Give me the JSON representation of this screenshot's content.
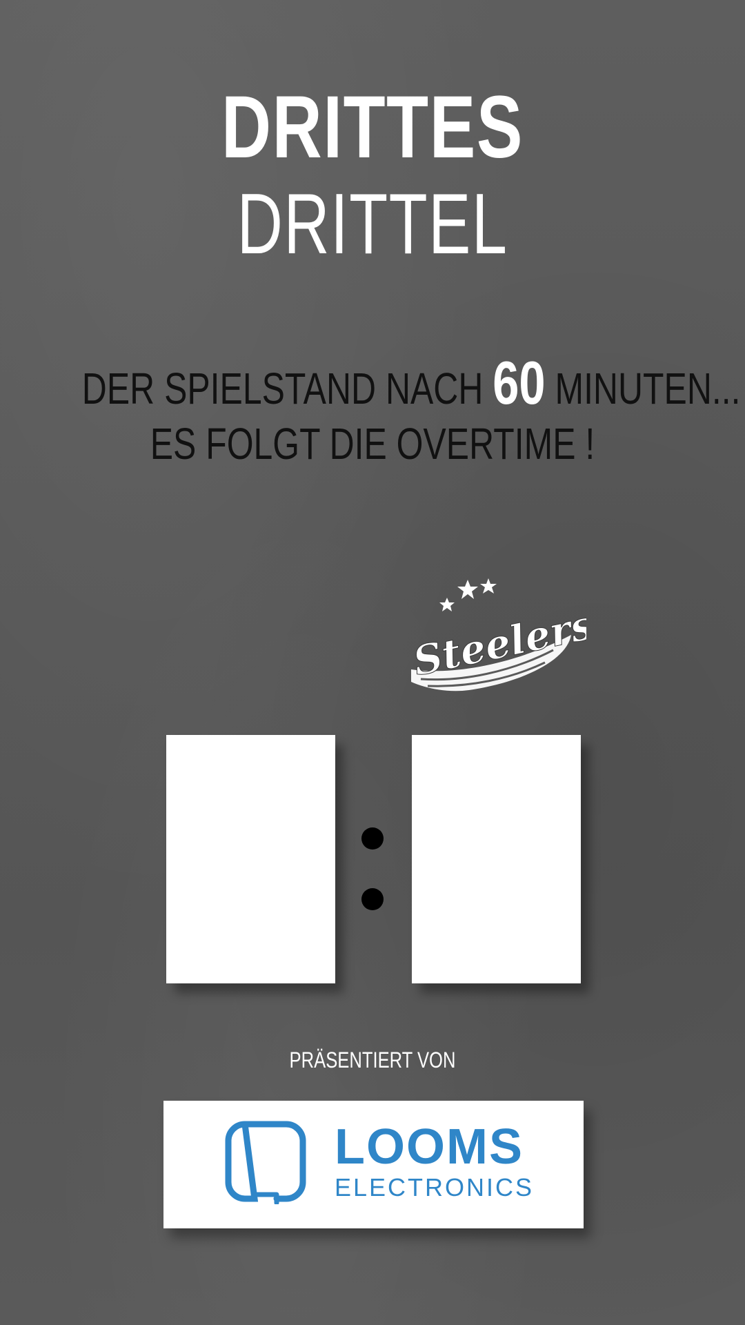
{
  "title": {
    "line1": "DRITTES",
    "line2": "DRITTEL"
  },
  "subtitle": {
    "line1_prefix": "DER SPIELSTAND NACH",
    "line1_number": "60",
    "line1_suffix": "MINUTEN...",
    "line2": "ES FOLGT DIE OVERTIME !"
  },
  "team_logo": {
    "text": "Steelers",
    "icon": "steelers-logo"
  },
  "score": {
    "separator_icon": "colon-dots"
  },
  "sponsor": {
    "intro": "PRÄSENTIERT VON",
    "name": "LOOMS",
    "sub": "ELECTRONICS",
    "icon": "looms-logo-icon",
    "color": "#2f86c8"
  },
  "colors": {
    "background": "#5a5a5a",
    "title": "#ffffff",
    "subtitle": "#111111",
    "accent": "#2f86c8"
  }
}
